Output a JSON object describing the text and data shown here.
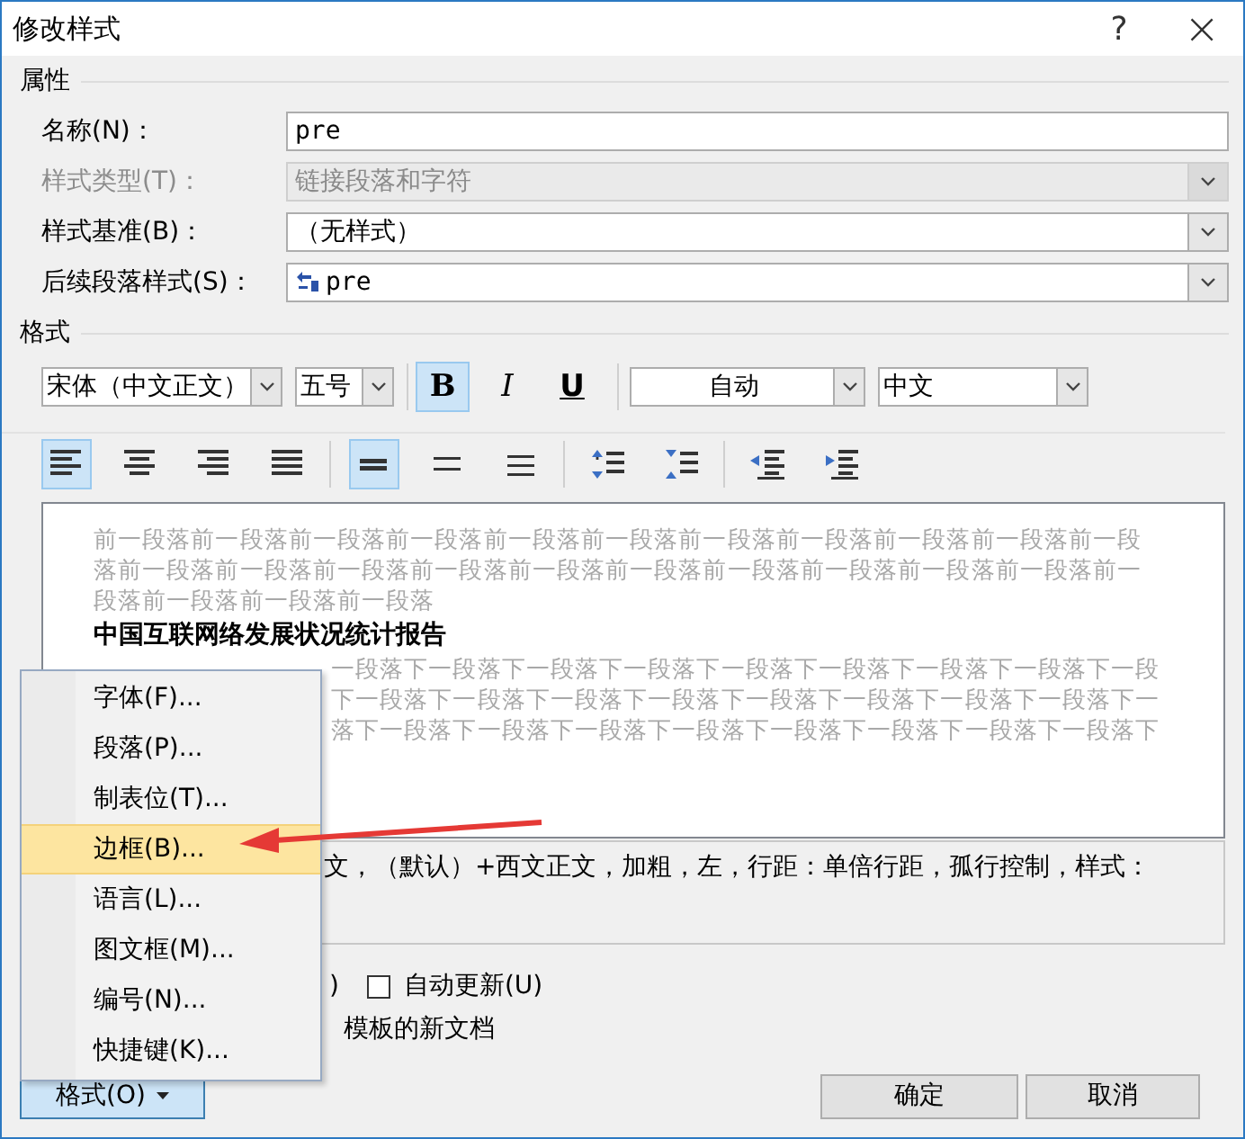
{
  "window": {
    "title": "修改样式",
    "help": "?",
    "close": "×"
  },
  "properties": {
    "heading": "属性",
    "fields": [
      {
        "label": "名称(N)：",
        "value": "pre",
        "kind": "text",
        "disabled": false
      },
      {
        "label": "样式类型(T)：",
        "value": "链接段落和字符",
        "kind": "select",
        "disabled": true
      },
      {
        "label": "样式基准(B)：",
        "value": "（无样式）",
        "kind": "select",
        "disabled": false
      },
      {
        "label": "后续段落样式(S)：",
        "value": "pre",
        "kind": "style-select",
        "disabled": false
      }
    ]
  },
  "format": {
    "heading": "格式",
    "font": "宋体（中文正文）",
    "size": "五号",
    "styles": [
      {
        "kind": "bold",
        "label": "B",
        "selected": true
      },
      {
        "kind": "italic",
        "label": "I",
        "selected": false
      },
      {
        "kind": "underline",
        "label": "U",
        "selected": false
      }
    ],
    "tint": "自动",
    "script": "中文",
    "paragraph_buttons": [
      {
        "kind": "align-left",
        "selected": true
      },
      {
        "kind": "align-center",
        "selected": false
      },
      {
        "kind": "align-right",
        "selected": false
      },
      {
        "kind": "justify",
        "selected": false
      },
      {
        "kind": "single-spacing",
        "selected": true
      },
      {
        "kind": "one-half-spacing",
        "selected": false
      },
      {
        "kind": "double-spacing",
        "selected": false
      },
      {
        "kind": "increase-spacing",
        "selected": false
      },
      {
        "kind": "decrease-spacing",
        "selected": false
      },
      {
        "kind": "decrease-indent",
        "selected": false
      },
      {
        "kind": "increase-indent",
        "selected": false
      }
    ]
  },
  "preview": {
    "before_lines": [
      "前一段落前一段落前一段落前一段落前一段落前一段落前一段落前一段落前一段落前一段落前一段",
      "落前一段落前一段落前一段落前一段落前一段落前一段落前一段落前一段落前一段落前一段落前一",
      "段落前一段落前一段落前一段落"
    ],
    "sample": "中国互联网络发展状况统计报告",
    "after_lines": [
      "一段落下一段落下一段落下一段落下一段落下一段落下一段落下一段落下一段",
      "下一段落下一段落下一段落下一段落下一段落下一段落下一段落下一段落下一",
      "落下一段落下一段落下一段落下一段落下一段落下一段落下一段落下一段落下"
    ]
  },
  "description": "文，（默认）+西文正文，加粗，左，行距：单倍行距，孤行控制，样式：",
  "options": {
    "gallery_label": ")",
    "auto_update": {
      "label": "自动更新(U)",
      "checked": false
    },
    "template_label": "模板的新文档"
  },
  "menu": [
    {
      "label": "字体(F)...",
      "selected": false
    },
    {
      "label": "段落(P)...",
      "selected": false
    },
    {
      "label": "制表位(T)...",
      "selected": false
    },
    {
      "label": "边框(B)...",
      "selected": true
    },
    {
      "label": "语言(L)...",
      "selected": false
    },
    {
      "label": "图文框(M)...",
      "selected": false
    },
    {
      "label": "编号(N)...",
      "selected": false
    },
    {
      "label": "快捷键(K)...",
      "selected": false
    }
  ],
  "buttons": {
    "format": "格式(O)",
    "ok": "确定",
    "cancel": "取消"
  }
}
